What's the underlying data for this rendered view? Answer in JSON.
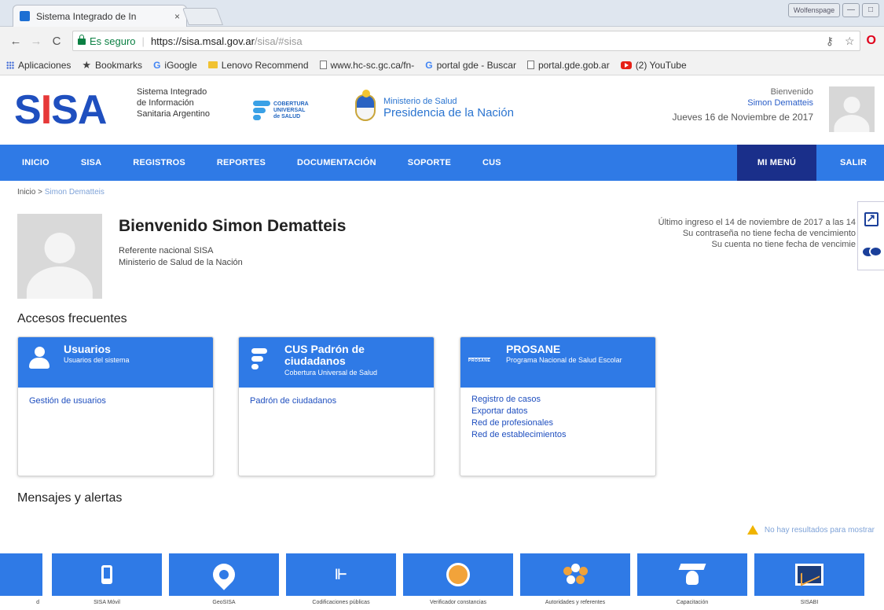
{
  "browser": {
    "tab_title": "Sistema Integrado de In",
    "tab_close": "×",
    "window_profile": "Wolfenspage",
    "window_min": "—",
    "window_max": "□",
    "secure_label": "Es seguro",
    "url_host": "https://sisa.msal.gov.ar",
    "url_path": "/sisa/#sisa",
    "bookmarks": [
      {
        "label": "Aplicaciones",
        "icon": "apps-icon"
      },
      {
        "label": "Bookmarks",
        "icon": "star-icon"
      },
      {
        "label": "iGoogle",
        "icon": "google-icon"
      },
      {
        "label": "Lenovo Recommend",
        "icon": "folder-icon"
      },
      {
        "label": "www.hc-sc.gc.ca/fn-",
        "icon": "page-icon"
      },
      {
        "label": "portal gde - Buscar",
        "icon": "google-icon"
      },
      {
        "label": "portal.gde.gob.ar",
        "icon": "page-icon"
      },
      {
        "label": "(2) YouTube",
        "icon": "youtube-icon"
      }
    ]
  },
  "header": {
    "logo_s": "S",
    "logo_i": "I",
    "logo_rest": "SA",
    "logo_desc": [
      "Sistema Integrado",
      "de Información",
      "Sanitaria Argentino"
    ],
    "cus_logo_text": [
      "COBERTURA",
      "UNIVERSAL",
      "de SALUD"
    ],
    "ministerio": "Ministerio de Salud",
    "presidencia": "Presidencia de la Nación",
    "welcome_label": "Bienvenido",
    "user_name": "Simon Dematteis",
    "date": "Jueves 16 de Noviembre de 2017"
  },
  "nav": {
    "items": [
      "INICIO",
      "SISA",
      "REGISTROS",
      "REPORTES",
      "DOCUMENTACIÓN",
      "SOPORTE",
      "CUS"
    ],
    "mimenu": "MI MENÚ",
    "salir": "SALIR"
  },
  "breadcrumb": {
    "home": "Inicio",
    "sep": " > ",
    "current": "Simon Dematteis"
  },
  "profile": {
    "greeting": "Bienvenido Simon Dematteis",
    "role": "Referente nacional SISA",
    "org": "Ministerio de Salud de la Nación",
    "last_login": "Último ingreso el 14 de noviembre de 2017 a las 14",
    "password_note": "Su contraseña no tiene fecha de vencimiento",
    "account_note": "Su cuenta no tiene fecha de vencimie"
  },
  "sections": {
    "frequent": "Accesos frecuentes",
    "messages": "Mensajes y alertas",
    "no_results": "No hay resultados para mostrar"
  },
  "cards": [
    {
      "title": "Usuarios",
      "subtitle": "Usuarios del sistema",
      "links": [
        "Gestión de usuarios"
      ]
    },
    {
      "title": "CUS Padrón de ciudadanos",
      "subtitle": "Cobertura Universal de Salud",
      "links": [
        "Padrón de ciudadanos"
      ]
    },
    {
      "title": "PROSANE",
      "subtitle": "Programa Nacional de Salud Escolar",
      "logo_text": "PROSANE",
      "links": [
        "Registro de casos",
        "Exportar datos",
        "Red de profesionales",
        "Red de establecimientos"
      ]
    }
  ],
  "tiles": [
    {
      "label": "d",
      "icon": ""
    },
    {
      "label": "SISA Móvil",
      "icon": "phone-icon"
    },
    {
      "label": "GeoSISA",
      "icon": "map-pin-icon"
    },
    {
      "label": "Codificaciones públicas",
      "icon": "tree-icon"
    },
    {
      "label": "Verificador constancias",
      "icon": "document-search-icon"
    },
    {
      "label": "Autoridades y referentes",
      "icon": "people-icon"
    },
    {
      "label": "Capacitación",
      "icon": "graduation-icon"
    },
    {
      "label": "SISABI",
      "icon": "monitor-chart-icon"
    }
  ],
  "colors": {
    "nav_blue": "#2f7ae6",
    "mimenu_navy": "#1a2f8a",
    "link_blue": "#1f4fbf",
    "logo_red": "#e63838"
  }
}
